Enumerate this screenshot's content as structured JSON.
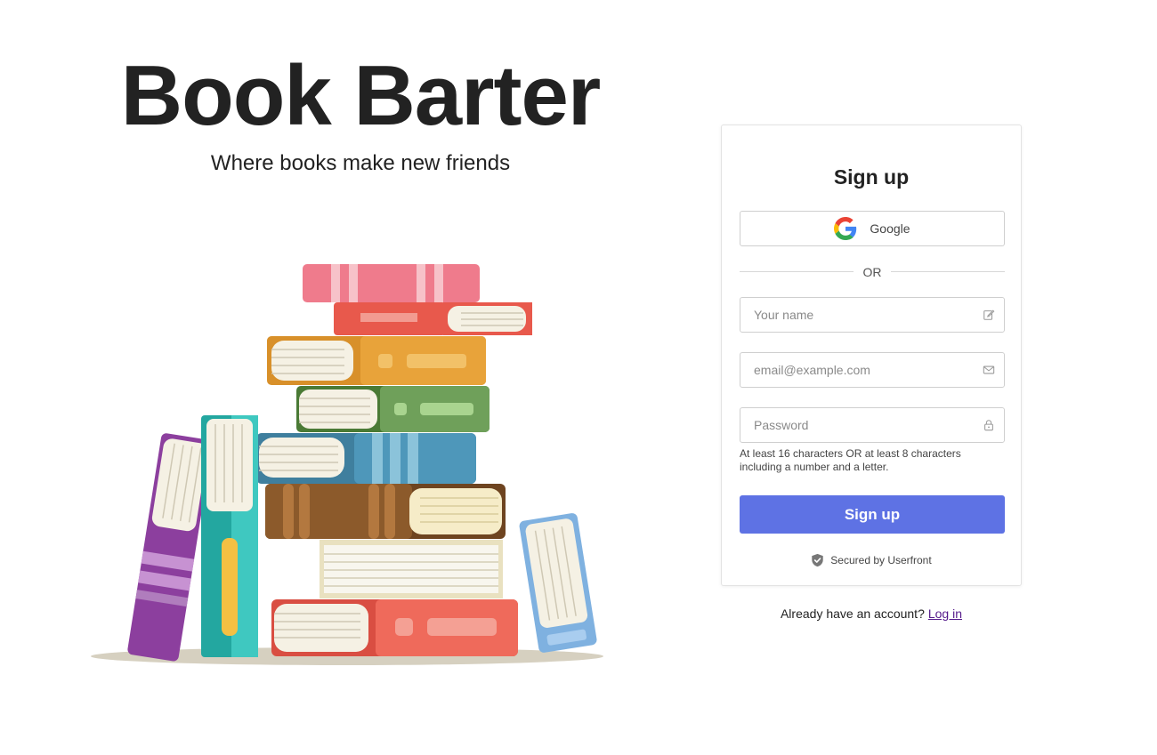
{
  "brand": {
    "title": "Book Barter",
    "tagline": "Where books make new friends"
  },
  "illustration": {
    "subject": "stack-of-books-icon"
  },
  "signup": {
    "title": "Sign up",
    "google_label": "Google",
    "divider_text": "OR",
    "name_placeholder": "Your name",
    "email_placeholder": "email@example.com",
    "password_placeholder": "Password",
    "password_hint": "At least 16 characters OR at least 8 characters including a number and a letter.",
    "submit_label": "Sign up",
    "secured_text": "Secured by Userfront"
  },
  "login": {
    "prompt": "Already have an account?",
    "link_label": "Log in"
  },
  "colors": {
    "accent": "#5e72e4",
    "text": "#222222",
    "border": "#cfcfcf"
  },
  "icons": {
    "google": "google-logo-icon",
    "name": "edit-icon",
    "email": "mail-icon",
    "password": "lock-icon",
    "secured": "shield-check-icon"
  }
}
